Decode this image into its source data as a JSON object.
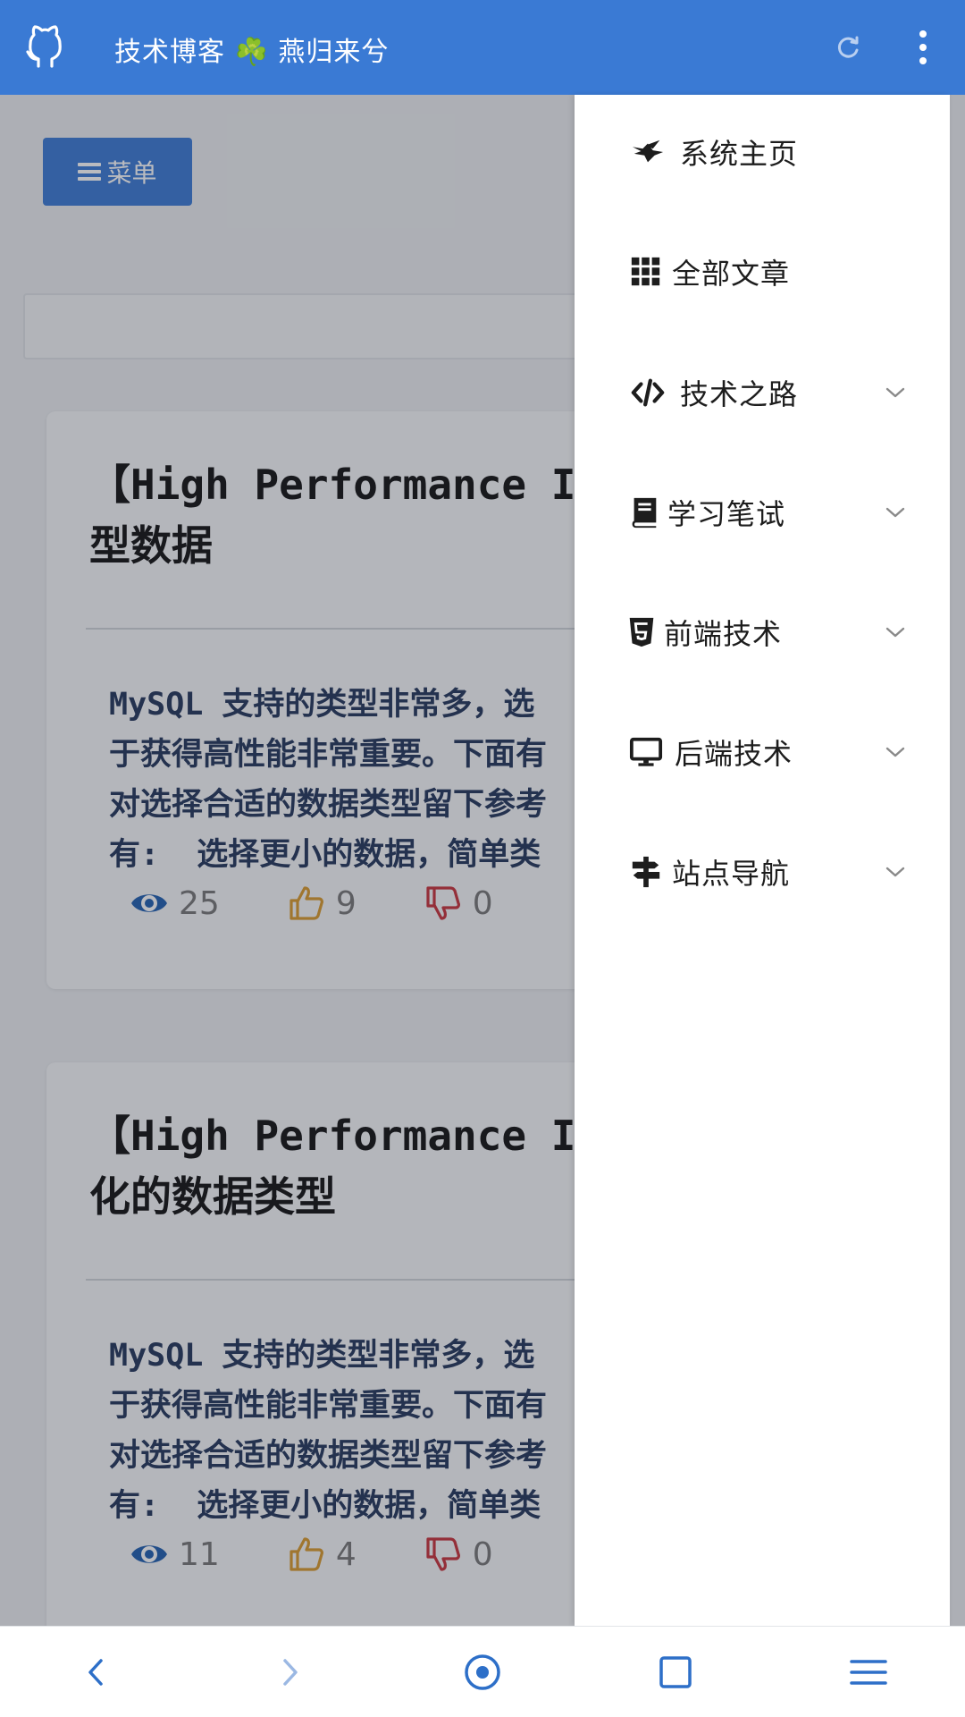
{
  "topbar": {
    "title": "技术博客 ☘️ 燕归来兮",
    "icons": [
      "github-icon",
      "refresh-icon",
      "more-vertical-icon"
    ]
  },
  "main": {
    "menu_button_label": "菜单",
    "articles": [
      {
        "title": "【High Performance I\n型数据",
        "excerpt": "MySQL 支持的类型非常多，选\n于获得高性能非常重要。下面有\n对选择合适的数据类型留下参考\n有:  选择更小的数据，简单类",
        "views": "25",
        "likes": "9",
        "dislikes": "0"
      },
      {
        "title": "【High Performance I\n化的数据类型",
        "excerpt": "MySQL 支持的类型非常多，选\n于获得高性能非常重要。下面有\n对选择合适的数据类型留下参考\n有:  选择更小的数据，简单类",
        "views": "11",
        "likes": "4",
        "dislikes": "0"
      }
    ]
  },
  "drawer": {
    "items": [
      {
        "label": "系统主页",
        "icon": "bird-logo-icon",
        "expandable": false
      },
      {
        "label": "全部文章",
        "icon": "grid-icon",
        "expandable": false
      },
      {
        "label": "技术之路",
        "icon": "code-icon",
        "expandable": true
      },
      {
        "label": "学习笔试",
        "icon": "book-icon",
        "expandable": true
      },
      {
        "label": "前端技术",
        "icon": "html5-icon",
        "expandable": true
      },
      {
        "label": "后端技术",
        "icon": "desktop-icon",
        "expandable": true
      },
      {
        "label": "站点导航",
        "icon": "signpost-icon",
        "expandable": true
      }
    ]
  },
  "bottom_nav": [
    "back-icon",
    "forward-icon",
    "home-icon",
    "tabs-icon",
    "menu-icon"
  ],
  "colors": {
    "accent": "#3a7ad4",
    "view_icon": "#1f5fb0",
    "like_icon": "#d99a2b",
    "dislike_icon": "#c8323a"
  }
}
